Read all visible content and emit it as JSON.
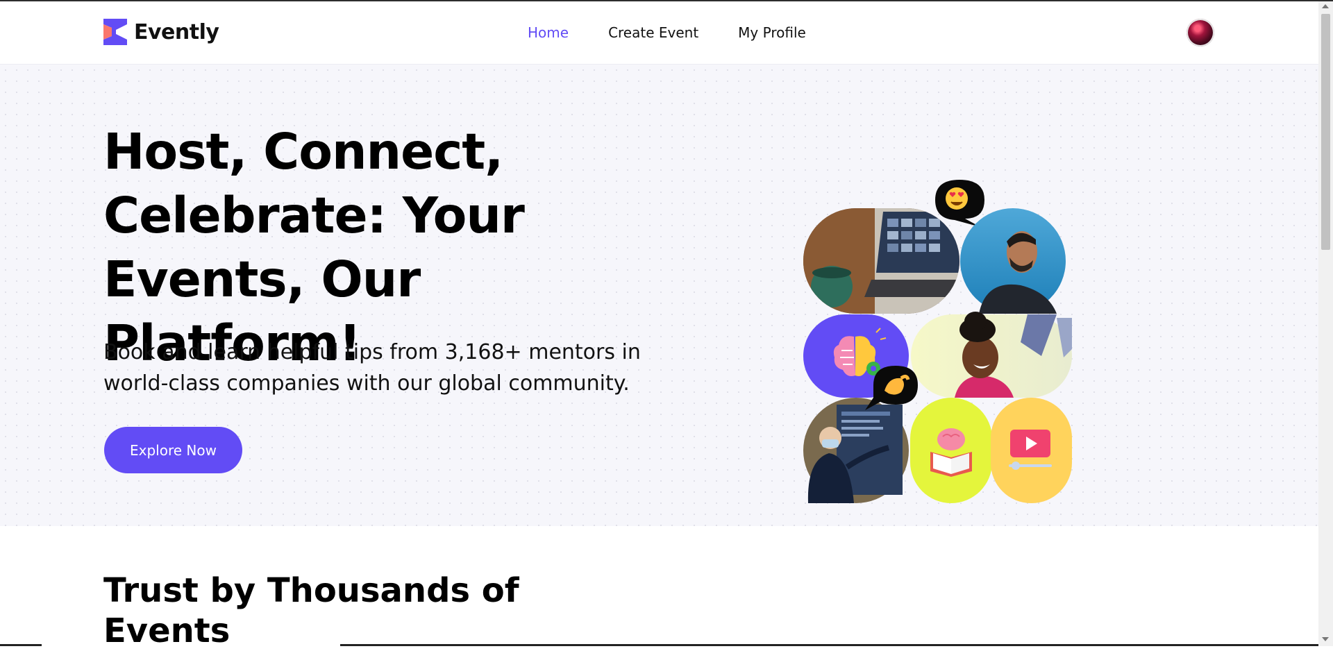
{
  "brand": {
    "name": "Evently",
    "logo_colors": [
      "#fa776c",
      "#624cf5"
    ]
  },
  "nav": {
    "items": [
      {
        "label": "Home",
        "active": true
      },
      {
        "label": "Create Event",
        "active": false
      },
      {
        "label": "My Profile",
        "active": false
      }
    ],
    "active_color": "#624cf5"
  },
  "user": {
    "avatar_icon": "user-avatar"
  },
  "hero": {
    "title": "Host, Connect, Celebrate: Your Events, Our Platform!",
    "subtitle": "Book and learn helpful tips from 3,168+ mentors in world-class companies with our global community.",
    "cta_label": "Explore Now",
    "collage_icons": [
      "laptop-video-call-photo",
      "smiling-man-photo",
      "heart-eyes-emoji",
      "brain-gear-icon",
      "laughing-woman-photo",
      "pinching-hand-emoji",
      "presenter-photo",
      "book-brain-icon",
      "video-play-icon"
    ],
    "collage_colors": [
      "#624cf5",
      "#e4f53c",
      "#ffd35c"
    ]
  },
  "trust": {
    "title": "Trust by Thousands of Events"
  },
  "colors": {
    "accent": "#624cf5",
    "hero_bg": "#f6f6fb"
  }
}
